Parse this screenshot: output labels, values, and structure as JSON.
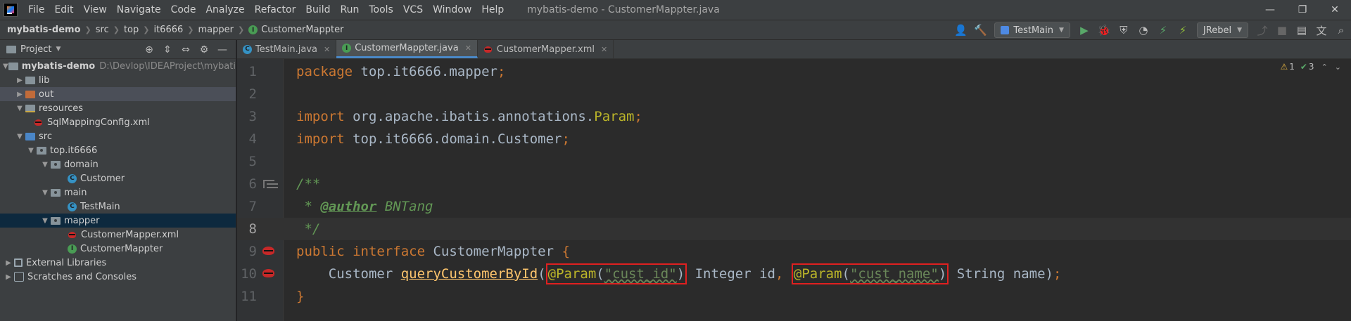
{
  "menubar": {
    "items": [
      "File",
      "Edit",
      "View",
      "Navigate",
      "Code",
      "Analyze",
      "Refactor",
      "Build",
      "Run",
      "Tools",
      "VCS",
      "Window",
      "Help"
    ],
    "window_title": "mybatis-demo - CustomerMappter.java"
  },
  "navbar": {
    "crumbs": [
      "mybatis-demo",
      "src",
      "top",
      "it6666",
      "mapper",
      "CustomerMappter"
    ]
  },
  "toolbar": {
    "run_config": "TestMain",
    "jrebel": "JRebel"
  },
  "project": {
    "title": "Project",
    "tree": [
      {
        "label": "mybatis-demo",
        "hint": "D:\\Devlop\\IDEAProject\\mybatis-demo",
        "depth": 0,
        "expanded": true,
        "icon": "module-folder-icon"
      },
      {
        "label": "lib",
        "depth": 1,
        "expanded": false,
        "icon": "folder-icon"
      },
      {
        "label": "out",
        "depth": 1,
        "expanded": false,
        "icon": "excluded-folder-icon"
      },
      {
        "label": "resources",
        "depth": 1,
        "expanded": true,
        "icon": "resources-folder-icon"
      },
      {
        "label": "SqlMappingConfig.xml",
        "depth": 2,
        "icon": "xml-file-icon"
      },
      {
        "label": "src",
        "depth": 1,
        "expanded": true,
        "icon": "source-folder-icon"
      },
      {
        "label": "top.it6666",
        "depth": 2,
        "expanded": true,
        "icon": "package-icon"
      },
      {
        "label": "domain",
        "depth": 3,
        "expanded": true,
        "icon": "package-icon"
      },
      {
        "label": "Customer",
        "depth": 4,
        "icon": "class-icon"
      },
      {
        "label": "main",
        "depth": 3,
        "expanded": true,
        "icon": "package-icon"
      },
      {
        "label": "TestMain",
        "depth": 4,
        "icon": "class-icon"
      },
      {
        "label": "mapper",
        "depth": 3,
        "expanded": true,
        "icon": "package-icon"
      },
      {
        "label": "CustomerMapper.xml",
        "depth": 4,
        "icon": "mybatis-xml-icon"
      },
      {
        "label": "CustomerMappter",
        "depth": 4,
        "icon": "interface-icon"
      },
      {
        "label": "External Libraries",
        "depth": 0,
        "expanded": false,
        "icon": "external-libraries-icon"
      },
      {
        "label": "Scratches and Consoles",
        "depth": 0,
        "expanded": false,
        "icon": "scratches-icon"
      }
    ]
  },
  "tabs": [
    {
      "label": "TestMain.java",
      "active": false
    },
    {
      "label": "CustomerMappter.java",
      "active": true
    },
    {
      "label": "CustomerMapper.xml",
      "active": false
    }
  ],
  "inspections": {
    "warnings": "1",
    "ok": "3"
  },
  "editor": {
    "line_numbers": [
      "1",
      "2",
      "3",
      "4",
      "5",
      "6",
      "7",
      "8",
      "9",
      "10",
      "11"
    ],
    "current_line": "8",
    "lines": {
      "l1_kw": "package",
      "l1_pkg": " top.it6666.mapper",
      "l1_semi": ";",
      "l3_kw": "import",
      "l3_pkg": " org.apache.ibatis.annotations.",
      "l3_ann": "Param",
      "l3_semi": ";",
      "l4_kw": "import",
      "l4_pkg": " top.it6666.domain.Customer",
      "l4_semi": ";",
      "l6": "/**",
      "l7_star": " * ",
      "l7_tag": "@author",
      "l7_name": " BNTang",
      "l8": " */",
      "l9_kw1": "public",
      "l9_kw2": " interface",
      "l9_name": " CustomerMappter ",
      "l9_brace": "{",
      "l10_type": "    Customer ",
      "l10_method": "queryCustomerById",
      "l10_paren": "(",
      "l10_ann1": "@Param",
      "l10_p1o": "(",
      "l10_str1": "\"cust_id\"",
      "l10_p1c": ")",
      "l10_mid": " Integer id",
      "l10_comma": ",",
      "l10_space": " ",
      "l10_ann2": "@Param",
      "l10_p2o": "(",
      "l10_str2": "\"cust_name\"",
      "l10_p2c": ")",
      "l10_end": " String name)",
      "l10_semi": ";",
      "l11": "}"
    }
  }
}
